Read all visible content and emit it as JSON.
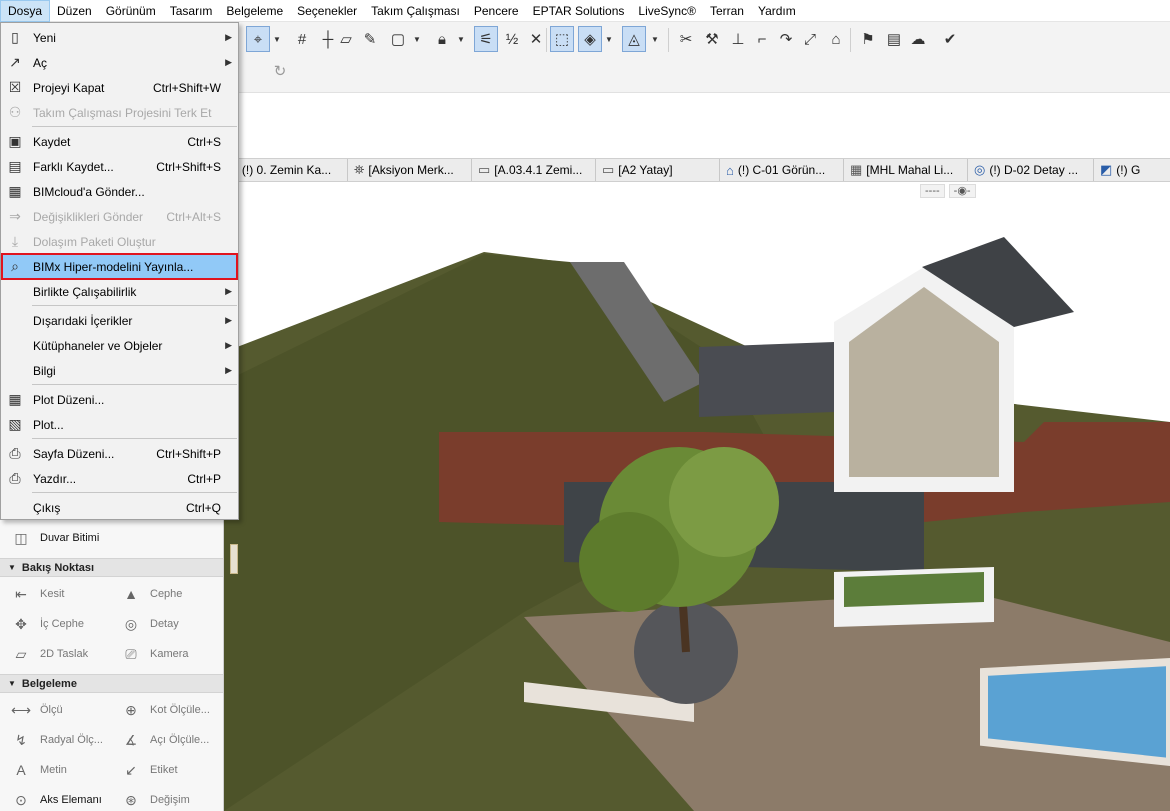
{
  "menubar": {
    "items": [
      "Dosya",
      "Düzen",
      "Görünüm",
      "Tasarım",
      "Belgeleme",
      "Seçenekler",
      "Takım Çalışması",
      "Pencere",
      "EPTAR Solutions",
      "LiveSync®",
      "Terran",
      "Yardım"
    ]
  },
  "file_menu": {
    "items": [
      {
        "label": "Yeni",
        "shortcut": "",
        "submenu": true,
        "disabled": false,
        "icon": "new-doc-icon"
      },
      {
        "label": "Aç",
        "shortcut": "",
        "submenu": true,
        "disabled": false,
        "icon": "open-folder-icon"
      },
      {
        "label": "Projeyi Kapat",
        "shortcut": "Ctrl+Shift+W",
        "submenu": false,
        "disabled": false,
        "icon": "close-doc-icon"
      },
      {
        "label": "Takım Çalışması Projesini Terk Et",
        "shortcut": "",
        "submenu": false,
        "disabled": true,
        "icon": "leave-team-icon"
      },
      {
        "label": "Kaydet",
        "shortcut": "Ctrl+S",
        "submenu": false,
        "disabled": false,
        "icon": "save-icon"
      },
      {
        "label": "Farklı Kaydet...",
        "shortcut": "Ctrl+Shift+S",
        "submenu": false,
        "disabled": false,
        "icon": "save-as-icon"
      },
      {
        "label": "BIMcloud'a Gönder...",
        "shortcut": "",
        "submenu": false,
        "disabled": false,
        "icon": "bimcloud-icon"
      },
      {
        "label": "Değişiklikleri Gönder",
        "shortcut": "Ctrl+Alt+S",
        "submenu": false,
        "disabled": true,
        "icon": "send-changes-icon"
      },
      {
        "label": "Dolaşım Paketi Oluştur",
        "shortcut": "",
        "submenu": false,
        "disabled": true,
        "icon": "package-icon"
      },
      {
        "label": "BIMx Hiper-modelini Yayınla...",
        "shortcut": "",
        "submenu": false,
        "disabled": false,
        "icon": "bimx-icon"
      },
      {
        "label": "Birlikte Çalışabilirlik",
        "shortcut": "",
        "submenu": true,
        "disabled": false,
        "icon": ""
      },
      {
        "label": "Dışarıdaki İçerikler",
        "shortcut": "",
        "submenu": true,
        "disabled": false,
        "icon": ""
      },
      {
        "label": "Kütüphaneler ve Objeler",
        "shortcut": "",
        "submenu": true,
        "disabled": false,
        "icon": ""
      },
      {
        "label": "Bilgi",
        "shortcut": "",
        "submenu": true,
        "disabled": false,
        "icon": ""
      },
      {
        "label": "Plot Düzeni...",
        "shortcut": "",
        "submenu": false,
        "disabled": false,
        "icon": "plot-setup-icon"
      },
      {
        "label": "Plot...",
        "shortcut": "",
        "submenu": false,
        "disabled": false,
        "icon": "plot-icon"
      },
      {
        "label": "Sayfa Düzeni...",
        "shortcut": "Ctrl+Shift+P",
        "submenu": false,
        "disabled": false,
        "icon": "page-setup-icon"
      },
      {
        "label": "Yazdır...",
        "shortcut": "Ctrl+P",
        "submenu": false,
        "disabled": false,
        "icon": "printer-icon"
      },
      {
        "label": "Çıkış",
        "shortcut": "Ctrl+Q",
        "submenu": false,
        "disabled": false,
        "icon": ""
      }
    ]
  },
  "tabs": [
    {
      "label": "(!) 0. Zemin Ka...",
      "icon": "floor-plan-icon"
    },
    {
      "label": "[Aksiyon Merk...",
      "icon": "lighthouse-icon"
    },
    {
      "label": "[A.03.4.1 Zemi...",
      "icon": "layout-icon"
    },
    {
      "label": "[A2 Yatay]",
      "icon": "layout-icon"
    },
    {
      "label": "(!) C-01 Görün...",
      "icon": "elevation-icon"
    },
    {
      "label": "[MHL Mahal Li...",
      "icon": "schedule-icon"
    },
    {
      "label": "(!) D-02 Detay ...",
      "icon": "detail-icon"
    },
    {
      "label": "(!) G",
      "icon": "worksheet-icon"
    }
  ],
  "toolbox": {
    "wall_end": "Duvar Bitimi",
    "section_viewpoint": "Bakış Noktası",
    "viewpoint_items": [
      "Kesit",
      "Cephe",
      "İç Cephe",
      "Detay",
      "2D Taslak",
      "Kamera"
    ],
    "section_documentation": "Belgeleme",
    "doc_items": [
      "Ölçü",
      "Kot Ölçüle...",
      "Radyal Ölç...",
      "Açı Ölçüle...",
      "Metin",
      "Etiket",
      "Aks Elemanı",
      "Değişim"
    ]
  },
  "colors": {
    "highlight": "#91c9f7",
    "highlight_border": "#e0141e",
    "menu_bg": "#f2f2f2"
  }
}
